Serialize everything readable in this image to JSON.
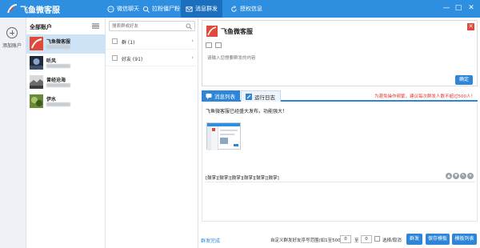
{
  "app": {
    "title": "飞鱼微客服",
    "nav": [
      "微信聊天",
      "拉粉僵尸粉",
      "消息群发",
      "授权信息"
    ],
    "active_nav": 2,
    "window_controls": [
      "—",
      "□",
      "✕"
    ]
  },
  "left_strip": {
    "add_label": "添加账户"
  },
  "accounts": {
    "header": "全部账户",
    "items": [
      {
        "name": "飞鱼微客服",
        "selected": true
      },
      {
        "name": "听风",
        "selected": false
      },
      {
        "name": "曾经沧海",
        "selected": false
      },
      {
        "name": "伊水",
        "selected": false
      }
    ]
  },
  "friends": {
    "search_placeholder": "搜索群或好友",
    "groups": [
      {
        "label": "群 (1)"
      },
      {
        "label": "好友 (91)"
      }
    ]
  },
  "compose": {
    "account_name": "飞鱼微客服",
    "input_placeholder": "请输入您想要群发的内容",
    "confirm_label": "确定"
  },
  "log": {
    "tabs": [
      "消息列表",
      "运行日志"
    ],
    "warning": "为避免操作频繁，建议每次群发人数不超过500人！",
    "message_text": "飞鱼微客服已经盛大发布，功能强大！",
    "emoji_text": "[鼓掌][鼓掌][鼓掌][鼓掌][鼓掌][鼓掌]"
  },
  "bottom": {
    "status_link": "群发完成",
    "range_label": "自定义群发好友序号范围(如1至500)：",
    "range_from": "0",
    "to_label": "至",
    "range_to": "0",
    "select_label": "选择/取消",
    "buttons": [
      "群发",
      "保存模板",
      "模板列表"
    ]
  },
  "colors": {
    "accent": "#2e8ee0",
    "brand_red": "#e04a3a",
    "warning": "#e03a2c"
  }
}
